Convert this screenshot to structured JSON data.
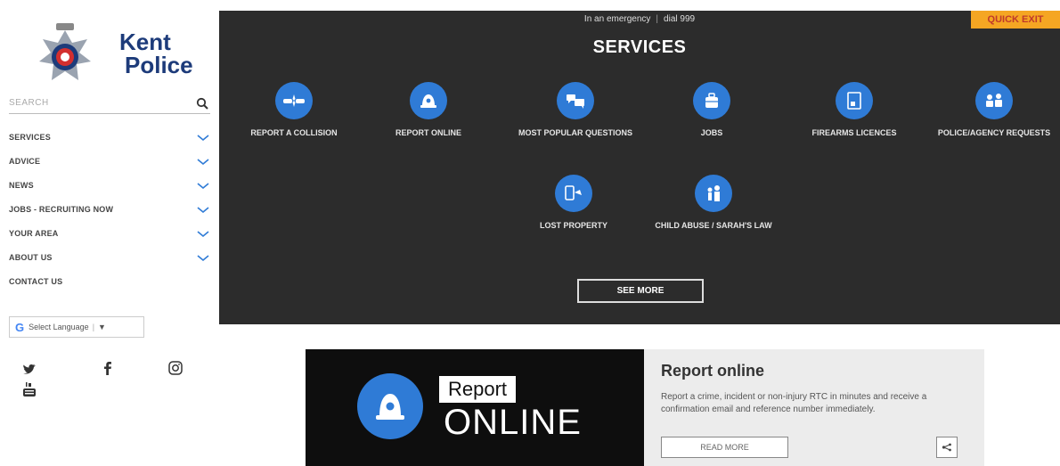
{
  "brand": {
    "line1": "Kent",
    "line2": "Police"
  },
  "search": {
    "placeholder": "SEARCH"
  },
  "nav": [
    {
      "label": "SERVICES",
      "has_chevron": true
    },
    {
      "label": "ADVICE",
      "has_chevron": true
    },
    {
      "label": "NEWS",
      "has_chevron": true
    },
    {
      "label": "JOBS - RECRUITING NOW",
      "has_chevron": true
    },
    {
      "label": "YOUR AREA",
      "has_chevron": true
    },
    {
      "label": "ABOUT US",
      "has_chevron": true
    },
    {
      "label": "CONTACT US",
      "has_chevron": false
    }
  ],
  "language": {
    "label": "Select Language",
    "arrow": "▼"
  },
  "social": [
    "twitter-icon",
    "facebook-icon",
    "instagram-icon",
    "youtube-icon"
  ],
  "header": {
    "emergency_text": "In an emergency",
    "dial_text": "dial 999",
    "quick_exit": "QUICK EXIT"
  },
  "services": {
    "title": "SERVICES",
    "tiles": [
      {
        "label": "REPORT A COLLISION",
        "icon": "collision-icon"
      },
      {
        "label": "REPORT ONLINE",
        "icon": "police-helmet-icon"
      },
      {
        "label": "MOST POPULAR QUESTIONS",
        "icon": "chat-bubbles-icon"
      },
      {
        "label": "JOBS",
        "icon": "briefcase-icon"
      },
      {
        "label": "FIREARMS LICENCES",
        "icon": "document-icon"
      },
      {
        "label": "POLICE/AGENCY REQUESTS",
        "icon": "people-icon"
      },
      {
        "label": "LOST PROPERTY",
        "icon": "lost-phone-icon"
      },
      {
        "label": "CHILD ABUSE / SARAH'S LAW",
        "icon": "child-adult-icon"
      }
    ],
    "see_more": "SEE MORE"
  },
  "feature": {
    "image_report": "Report",
    "image_online": "ONLINE",
    "title": "Report online",
    "description": "Report a crime, incident or non-injury RTC in minutes and receive a confirmation email and reference number immediately.",
    "read_more": "READ MORE"
  },
  "colors": {
    "dark_panel": "#2c2c2c",
    "accent_blue": "#2f7bd6",
    "quick_exit_bg": "#f5a623",
    "brand_navy": "#1d3b7a"
  }
}
